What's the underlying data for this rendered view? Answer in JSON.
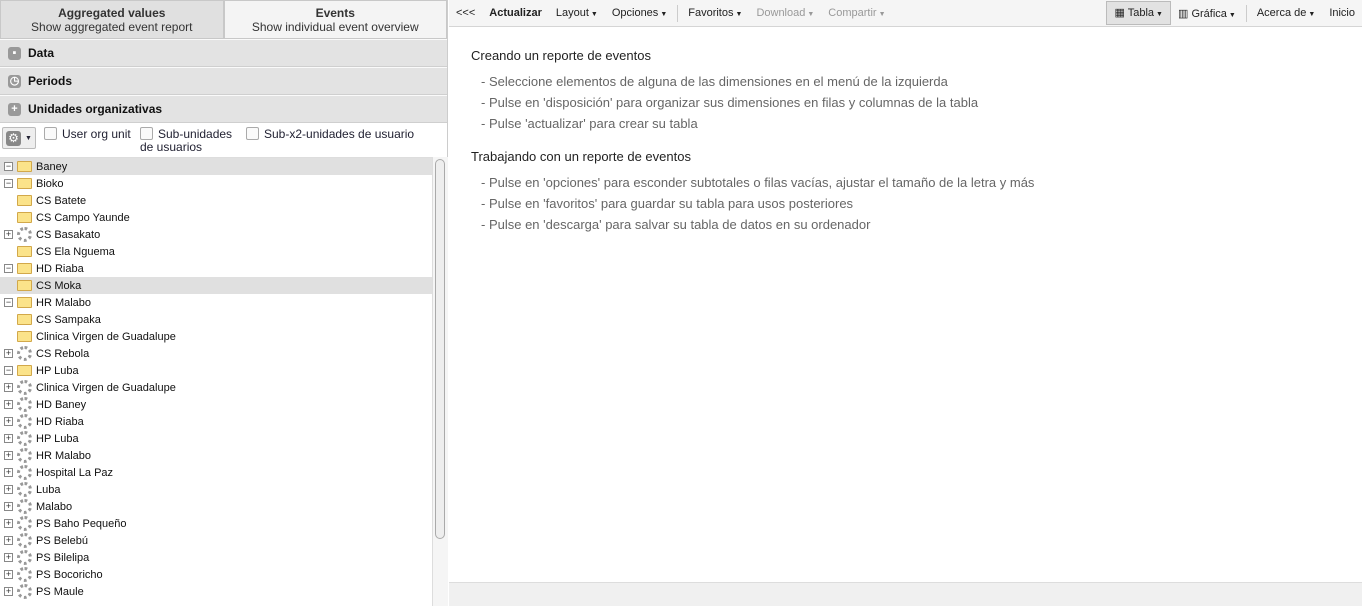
{
  "tabs": [
    {
      "title": "Aggregated values",
      "sub": "Show aggregated event report"
    },
    {
      "title": "Events",
      "sub": "Show individual event overview"
    }
  ],
  "accordion": [
    "Data",
    "Periods",
    "Unidades organizativas"
  ],
  "options": {
    "user_org_unit": "User org unit",
    "sub_units": "Sub-unidades de usuarios",
    "sub_x2": "Sub-x2-unidades de usuario"
  },
  "tree": [
    {
      "label": "Baney",
      "toggle": "-",
      "icon": "folder",
      "hl": true
    },
    {
      "label": "Bioko",
      "toggle": "-",
      "icon": "folder"
    },
    {
      "label": "CS Batete",
      "toggle": "",
      "icon": "folder"
    },
    {
      "label": "CS Campo Yaunde",
      "toggle": "",
      "icon": "folder"
    },
    {
      "label": "CS Basakato",
      "toggle": "+",
      "icon": "dots"
    },
    {
      "label": "CS Ela Nguema",
      "toggle": "",
      "icon": "folder"
    },
    {
      "label": "HD Riaba",
      "toggle": "-",
      "icon": "folder"
    },
    {
      "label": "CS Moka",
      "toggle": "",
      "icon": "folder",
      "hl": true
    },
    {
      "label": "HR Malabo",
      "toggle": "-",
      "icon": "folder"
    },
    {
      "label": "CS Sampaka",
      "toggle": "",
      "icon": "folder"
    },
    {
      "label": "Clinica Virgen de Guadalupe",
      "toggle": "",
      "icon": "folder"
    },
    {
      "label": "CS Rebola",
      "toggle": "+",
      "icon": "dots"
    },
    {
      "label": "HP Luba",
      "toggle": "-",
      "icon": "folder"
    },
    {
      "label": "Clinica Virgen de Guadalupe",
      "toggle": "+",
      "icon": "dots"
    },
    {
      "label": "HD Baney",
      "toggle": "+",
      "icon": "dots"
    },
    {
      "label": "HD Riaba",
      "toggle": "+",
      "icon": "dots"
    },
    {
      "label": "HP Luba",
      "toggle": "+",
      "icon": "dots"
    },
    {
      "label": "HR Malabo",
      "toggle": "+",
      "icon": "dots"
    },
    {
      "label": "Hospital La Paz",
      "toggle": "+",
      "icon": "dots"
    },
    {
      "label": "Luba",
      "toggle": "+",
      "icon": "dots"
    },
    {
      "label": "Malabo",
      "toggle": "+",
      "icon": "dots"
    },
    {
      "label": "PS Baho Pequeño",
      "toggle": "+",
      "icon": "dots"
    },
    {
      "label": "PS Belebú",
      "toggle": "+",
      "icon": "dots"
    },
    {
      "label": "PS Bilelipa",
      "toggle": "+",
      "icon": "dots"
    },
    {
      "label": "PS Bocoricho",
      "toggle": "+",
      "icon": "dots"
    },
    {
      "label": "PS Maule",
      "toggle": "+",
      "icon": "dots"
    }
  ],
  "toolbar": {
    "collapse": "<<<",
    "update": "Actualizar",
    "layout": "Layout",
    "options": "Opciones",
    "favorites": "Favoritos",
    "download": "Download",
    "share": "Compartir",
    "table": "Tabla",
    "chart": "Gráfica",
    "about": "Acerca de",
    "home": "Inicio"
  },
  "main": {
    "h1": "Creando un reporte de eventos",
    "list1": [
      "- Seleccione elementos de alguna de las dimensiones en el menú de la izquierda",
      "- Pulse en 'disposición' para organizar sus dimensiones en filas y columnas de la tabla",
      "- Pulse 'actualizar' para crear su tabla"
    ],
    "h2": "Trabajando con un reporte de eventos",
    "list2": [
      "- Pulse en 'opciones' para esconder subtotales o filas vacías, ajustar el tamaño de la letra y más",
      "- Pulse en 'favoritos' para guardar su tabla para usos posteriores",
      "- Pulse en 'descarga' para salvar su tabla de datos en su ordenador"
    ]
  }
}
